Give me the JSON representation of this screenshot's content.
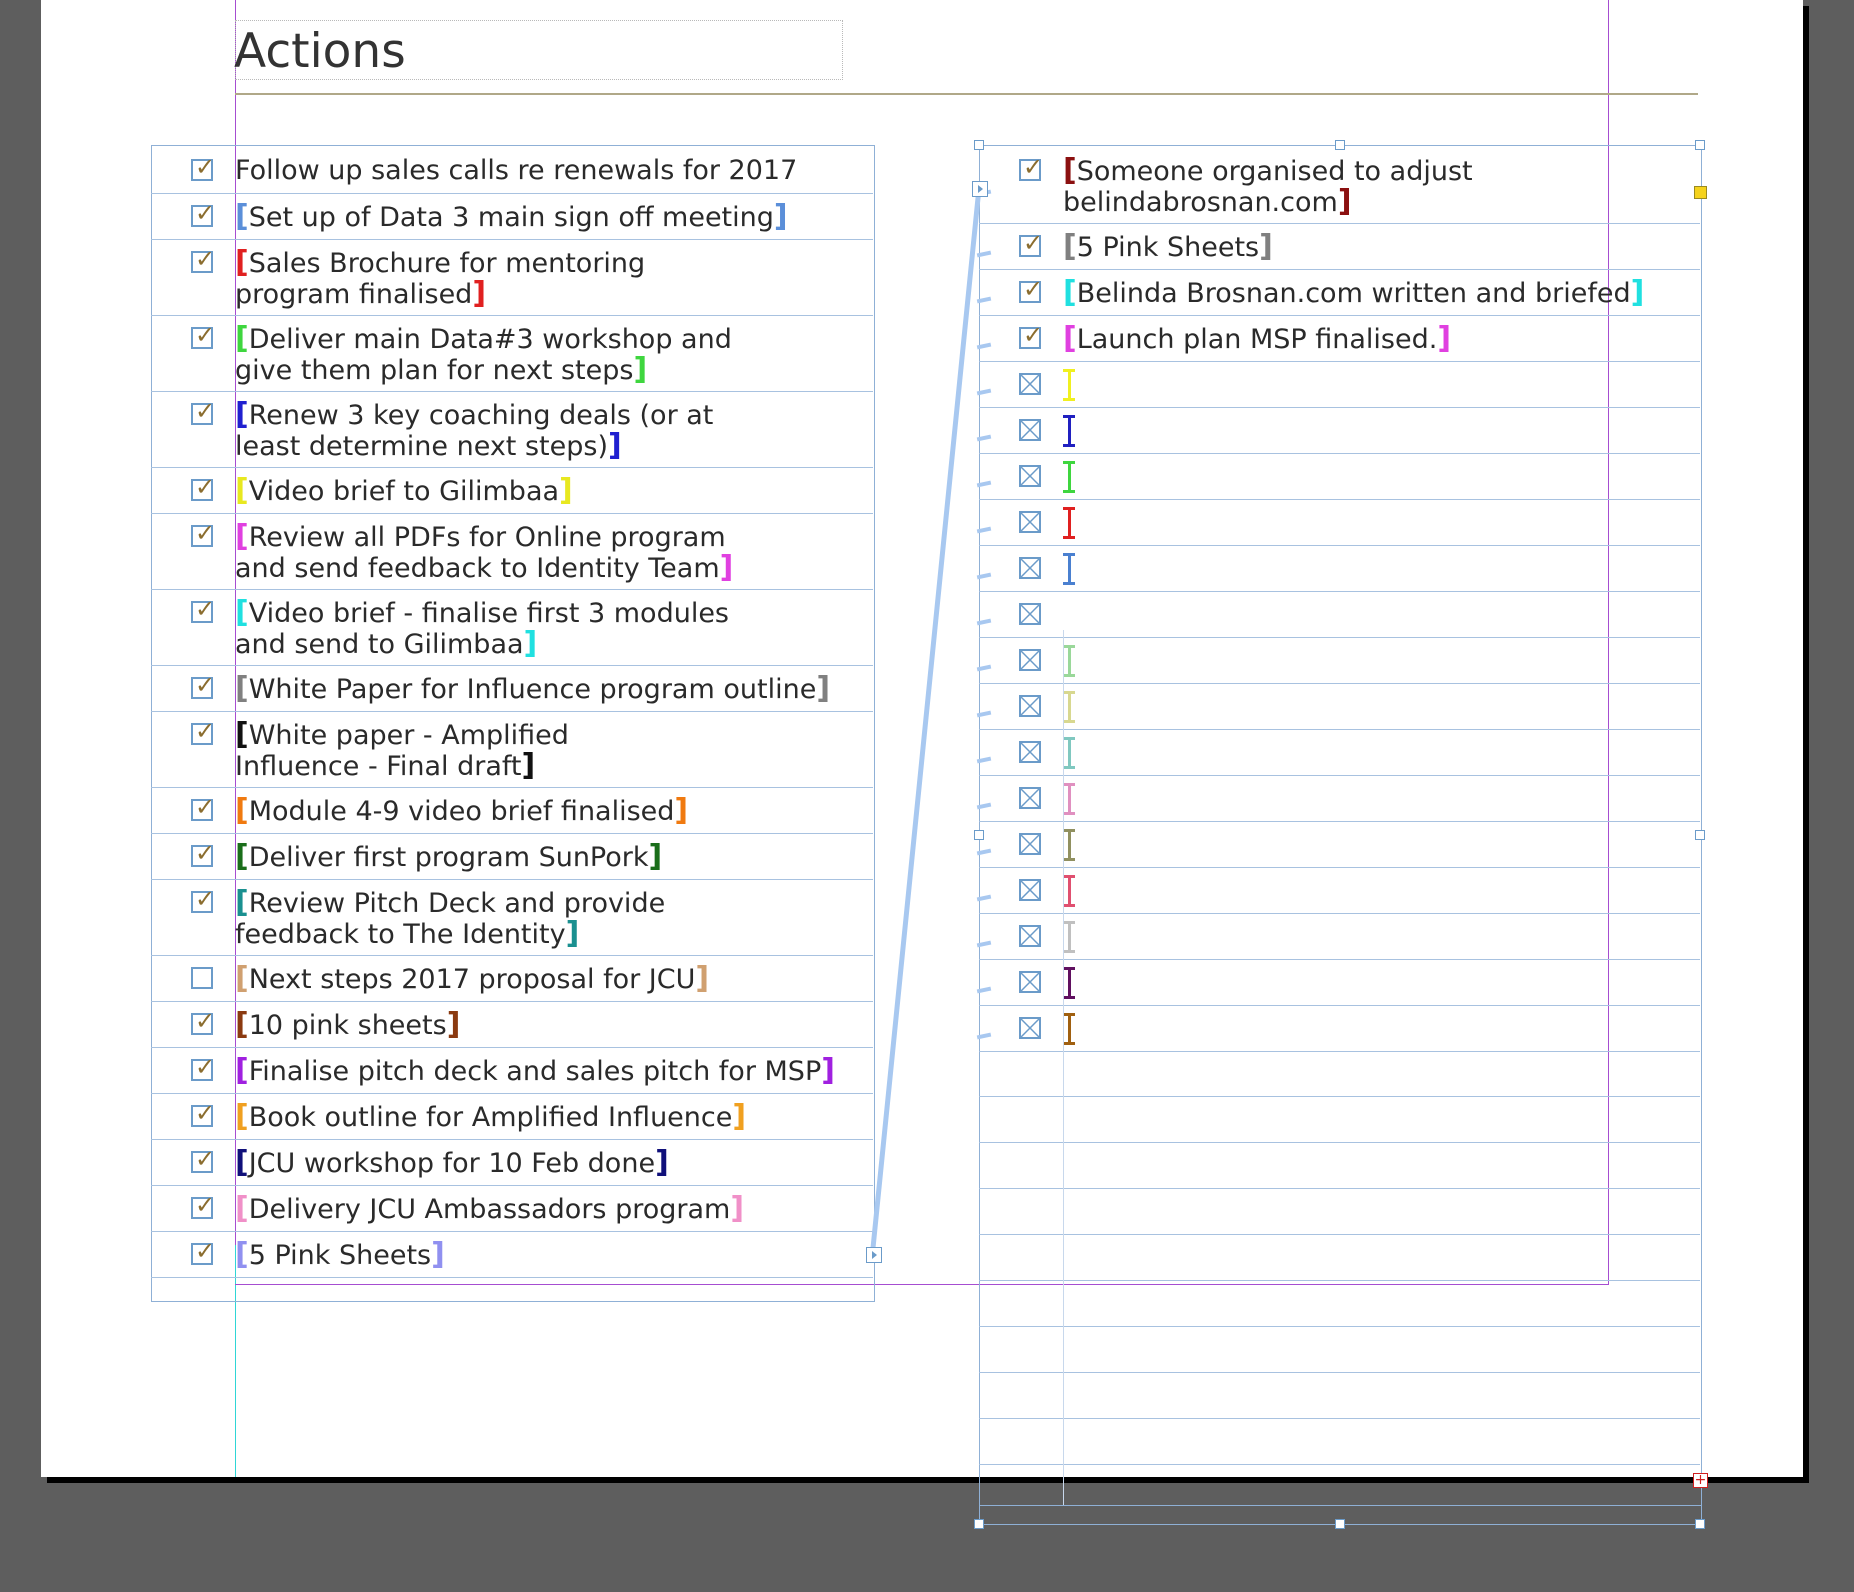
{
  "document": {
    "title": "Actions"
  },
  "colors": {
    "pasteboard": "#5e5e5e",
    "frame_border": "#8fb0d6",
    "tick": "#8b6d2f",
    "checkbox_border": "#6b9bc9",
    "margin_guide": "#a64dd1",
    "column_guide_cyan": "#2fd6d6",
    "thread_line": "#a8c8f0"
  },
  "left_list": {
    "items": [
      {
        "lines": [
          "Follow up sales calls re renewals for 2017"
        ],
        "state": "checked",
        "bracket": ""
      },
      {
        "lines": [
          "Set up of Data 3 main sign off meeting"
        ],
        "state": "checked",
        "bracket": "#5b8fd9"
      },
      {
        "lines": [
          "Sales Brochure for mentoring",
          "program finalised"
        ],
        "state": "checked",
        "bracket": "#e02020"
      },
      {
        "lines": [
          "Deliver main Data#3 workshop and",
          "give them plan for next steps"
        ],
        "state": "checked",
        "bracket": "#3fd63f"
      },
      {
        "lines": [
          "Renew 3 key coaching deals (or at",
          "least determine next steps)"
        ],
        "state": "checked",
        "bracket": "#2020d0"
      },
      {
        "lines": [
          "Video brief to Gilimbaa"
        ],
        "state": "checked",
        "bracket": "#e8e820"
      },
      {
        "lines": [
          "Review all PDFs for Online program",
          "and send feedback to Identity Team"
        ],
        "state": "checked",
        "bracket": "#e040e0"
      },
      {
        "lines": [
          "Video brief - finalise first 3 modules",
          "and send to Gilimbaa"
        ],
        "state": "checked",
        "bracket": "#20e0e0"
      },
      {
        "lines": [
          "White Paper for Influence program outline"
        ],
        "state": "checked",
        "bracket": "#808080"
      },
      {
        "lines": [
          "White paper - Amplified",
          "Influence - Final draft"
        ],
        "state": "checked",
        "bracket": "#111111"
      },
      {
        "lines": [
          "Module 4-9 video brief finalised"
        ],
        "state": "checked",
        "bracket": "#f07a10"
      },
      {
        "lines": [
          "Deliver first program SunPork"
        ],
        "state": "checked",
        "bracket": "#1a6e1a"
      },
      {
        "lines": [
          "Review Pitch Deck and provide",
          "feedback to The Identity"
        ],
        "state": "checked",
        "bracket": "#1a9090"
      },
      {
        "lines": [
          "Next steps 2017 proposal for JCU"
        ],
        "state": "unchecked",
        "bracket": "#d0a070"
      },
      {
        "lines": [
          "10 pink sheets"
        ],
        "state": "checked",
        "bracket": "#8b3a10"
      },
      {
        "lines": [
          "Finalise pitch deck and sales pitch for MSP"
        ],
        "state": "checked",
        "bracket": "#a020e0"
      },
      {
        "lines": [
          "Book outline for Amplified Influence"
        ],
        "state": "checked",
        "bracket": "#f0a020"
      },
      {
        "lines": [
          "JCU workshop for 10 Feb done"
        ],
        "state": "checked",
        "bracket": "#10107a"
      },
      {
        "lines": [
          "Delivery JCU Ambassadors program"
        ],
        "state": "checked",
        "bracket": "#f090c8"
      },
      {
        "lines": [
          "5 Pink Sheets"
        ],
        "state": "checked",
        "bracket": "#9090f0"
      }
    ]
  },
  "right_list": {
    "items": [
      {
        "lines": [
          "Someone organised to adjust",
          "belindabrosnan.com"
        ],
        "state": "checked",
        "bracket": "#8b1010"
      },
      {
        "lines": [
          "5 Pink Sheets"
        ],
        "state": "checked",
        "bracket": "#808080"
      },
      {
        "lines": [
          "Belinda Brosnan.com written and briefed"
        ],
        "state": "checked",
        "bracket": "#20e0e0"
      },
      {
        "lines": [
          "Launch plan MSP finalised."
        ],
        "state": "checked",
        "bracket": "#e040e0"
      },
      {
        "lines": [],
        "state": "crossed",
        "bracket": "#f0f020"
      },
      {
        "lines": [],
        "state": "crossed",
        "bracket": "#2020c0"
      },
      {
        "lines": [],
        "state": "crossed",
        "bracket": "#3fd63f"
      },
      {
        "lines": [],
        "state": "crossed",
        "bracket": "#e02020"
      },
      {
        "lines": [],
        "state": "crossed",
        "bracket": "#4a80d0"
      },
      {
        "lines": [],
        "state": "crossed",
        "bracket": ""
      },
      {
        "lines": [],
        "state": "crossed",
        "bracket": "#9ad89a"
      },
      {
        "lines": [],
        "state": "crossed",
        "bracket": "#d8d890"
      },
      {
        "lines": [],
        "state": "crossed",
        "bracket": "#80c8c0"
      },
      {
        "lines": [],
        "state": "crossed",
        "bracket": "#e090c0"
      },
      {
        "lines": [],
        "state": "crossed",
        "bracket": "#909060"
      },
      {
        "lines": [],
        "state": "crossed",
        "bracket": "#e05070"
      },
      {
        "lines": [],
        "state": "crossed",
        "bracket": "#c0c0c0"
      },
      {
        "lines": [],
        "state": "crossed",
        "bracket": "#601060"
      },
      {
        "lines": [],
        "state": "crossed",
        "bracket": "#a06010"
      }
    ],
    "empty_rows": 10
  }
}
